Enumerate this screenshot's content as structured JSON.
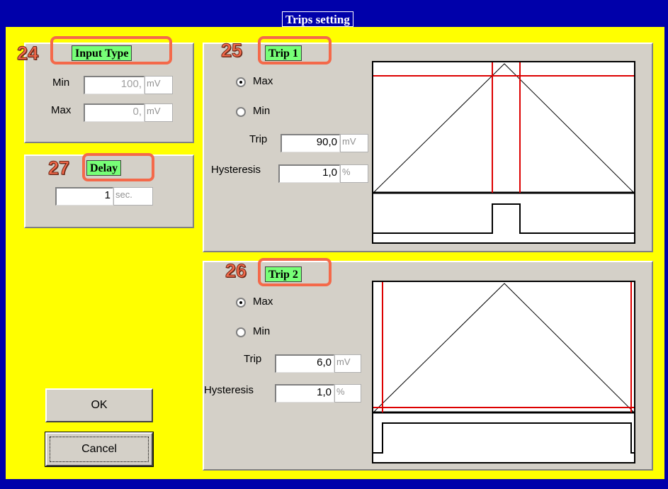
{
  "window": {
    "title": "Trips setting"
  },
  "input_type": {
    "badge": "24",
    "title": "Input Type",
    "min_label": "Min",
    "min_value": "100,",
    "min_unit": "mV",
    "max_label": "Max",
    "max_value": "0,",
    "max_unit": "mV"
  },
  "delay": {
    "badge": "27",
    "title": "Delay",
    "value": "1",
    "unit": "sec."
  },
  "trip1": {
    "badge": "25",
    "title": "Trip 1",
    "radio_max": "Max",
    "radio_min": "Min",
    "selected": "Max",
    "trip_label": "Trip",
    "trip_value": "90,0",
    "trip_unit": "mV",
    "hyst_label": "Hysteresis",
    "hyst_value": "1,0",
    "hyst_unit": "%"
  },
  "trip2": {
    "badge": "26",
    "title": "Trip 2",
    "radio_max": "Max",
    "radio_min": "Min",
    "selected": "Max",
    "trip_label": "Trip",
    "trip_value": "6,0",
    "trip_unit": "mV",
    "hyst_label": "Hysteresis",
    "hyst_value": "1,0",
    "hyst_unit": "%"
  },
  "buttons": {
    "ok": "OK",
    "cancel": "Cancel"
  },
  "colors": {
    "background": "#ffff00",
    "title_bar": "#0000aa",
    "group_title": "#77ff77",
    "badge": "#f4694a",
    "trip_line": "#dd0000"
  }
}
